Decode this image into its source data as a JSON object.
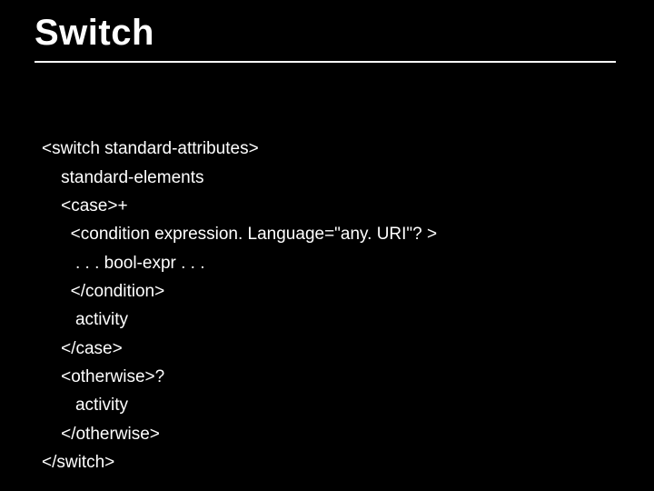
{
  "title": "Switch",
  "code": {
    "l1": "<switch standard-attributes>",
    "l2": "    standard-elements",
    "l3": "    <case>+",
    "l4": "      <condition expression. Language=\"any. URI\"? >",
    "l5": "       . . . bool-expr . . .",
    "l6": "      </condition>",
    "l7": "       activity",
    "l8": "    </case>",
    "l9": "    <otherwise>?",
    "l10": "       activity",
    "l11": "    </otherwise>",
    "l12": "</switch>"
  }
}
